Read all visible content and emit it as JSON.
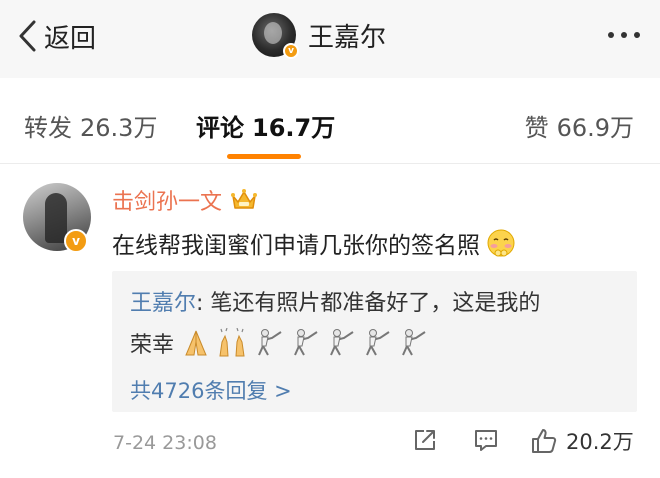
{
  "header": {
    "back_label": "返回",
    "title": "王嘉尔"
  },
  "tabs": [
    {
      "label": "转发",
      "count": "26.3万",
      "active": false
    },
    {
      "label": "评论",
      "count": "16.7万",
      "active": true
    },
    {
      "label": "赞",
      "count": "66.9万",
      "active": false
    }
  ],
  "comment": {
    "username": "击剑孙一文",
    "text": "在线帮我闺蜜们申请几张你的签名照",
    "reply": {
      "author": "王嘉尔",
      "separator": ": ",
      "text_line1": "笔还有照片都准备好了，这是我的",
      "text_line2": "荣幸"
    },
    "reply_count_label": "共4726条回复 >",
    "time": "7-24 23:08",
    "like_count": "20.2万"
  },
  "colors": {
    "accent": "#ff8200",
    "username": "#eb7350",
    "link": "#507daf",
    "verified_badge": "#f39c12"
  },
  "icons": [
    "chevron-left-icon",
    "more-dots-icon",
    "verified-badge-icon",
    "crown-icon",
    "shy-emoji-icon",
    "pray-emoji-icon",
    "raised-hands-emoji-icon",
    "fencer-emoji-icon",
    "share-icon",
    "comment-icon",
    "thumbs-up-icon"
  ]
}
